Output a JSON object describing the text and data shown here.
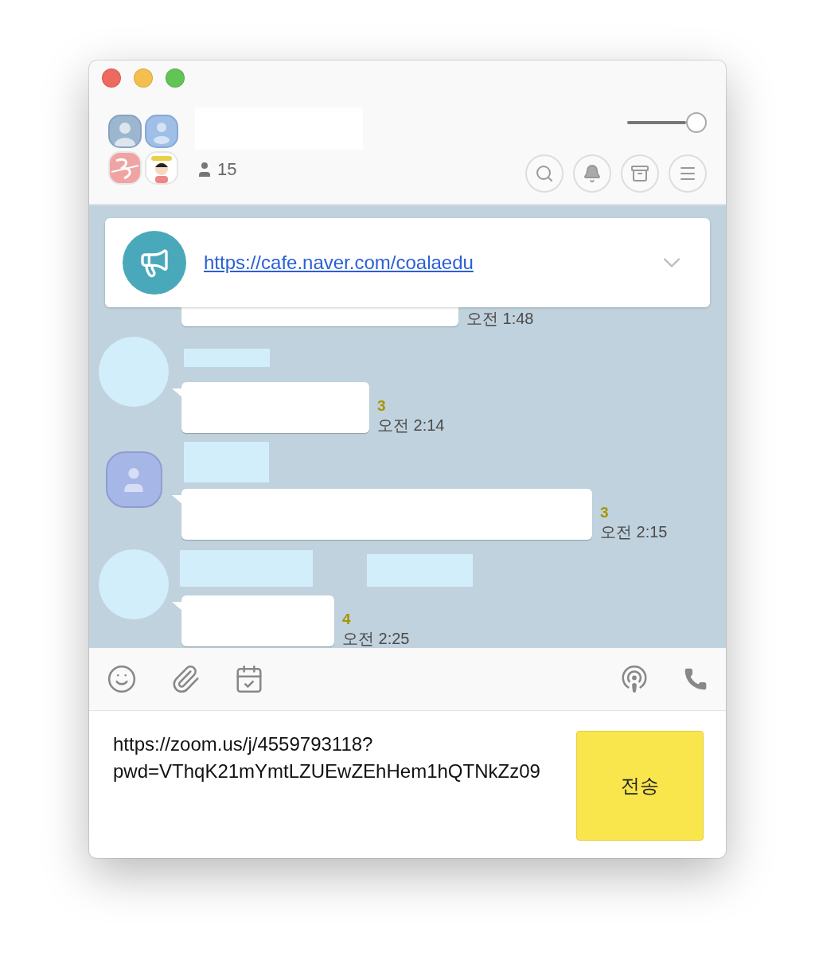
{
  "header": {
    "member_count": "15",
    "slider": {
      "level": 1
    }
  },
  "notice": {
    "link": "https://cafe.naver.com/coalaedu",
    "expanded": false
  },
  "messages": [
    {
      "kind": "hidden",
      "time": "오전 1:48"
    },
    {
      "kind": "blank",
      "unread": "3",
      "time": "오전 2:14"
    },
    {
      "kind": "person",
      "unread": "3",
      "time": "오전 2:15"
    },
    {
      "kind": "blank",
      "unread": "4",
      "time": "오전 2:25"
    }
  ],
  "composer": {
    "value": "https://zoom.us/j/4559793118?pwd=VThqK21mYmtLZUEwZEhHem1hQTNkZz09",
    "send_label": "전송"
  }
}
